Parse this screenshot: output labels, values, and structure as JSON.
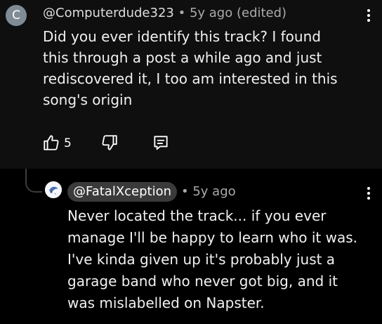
{
  "comment": {
    "avatar_letter": "C",
    "handle": "@Computerdude323",
    "separator": "•",
    "time": "5y ago (edited)",
    "lines": [
      "Did you ever identify this track? I found",
      "this through a post a while ago and just",
      "rediscovered it, I too am interested in this",
      "song's origin"
    ],
    "like_count": "5",
    "icons": {
      "like": "thumbs-up-icon",
      "dislike": "thumbs-down-icon",
      "reply": "reply-comment-icon",
      "more": "more-vert-icon"
    }
  },
  "reply": {
    "handle": "@FatalXception",
    "separator": "•",
    "time": "5y ago",
    "lines": [
      "Never located the track... if you ever",
      "manage I'll be happy to learn who it was.",
      "I've kinda given up it's probably just a",
      "garage band who never got big, and it",
      "was mislabelled on Napster."
    ],
    "icons": {
      "more": "more-vert-icon",
      "avatar": "avatar-image"
    }
  },
  "colors": {
    "background_top": "#0f0f0f",
    "background_bottom": "#000000",
    "text_primary": "#f1f1f1",
    "text_secondary": "#aaaaaa",
    "chip_bg": "#3a3a3a",
    "avatar_bg": "#7f8c96"
  }
}
